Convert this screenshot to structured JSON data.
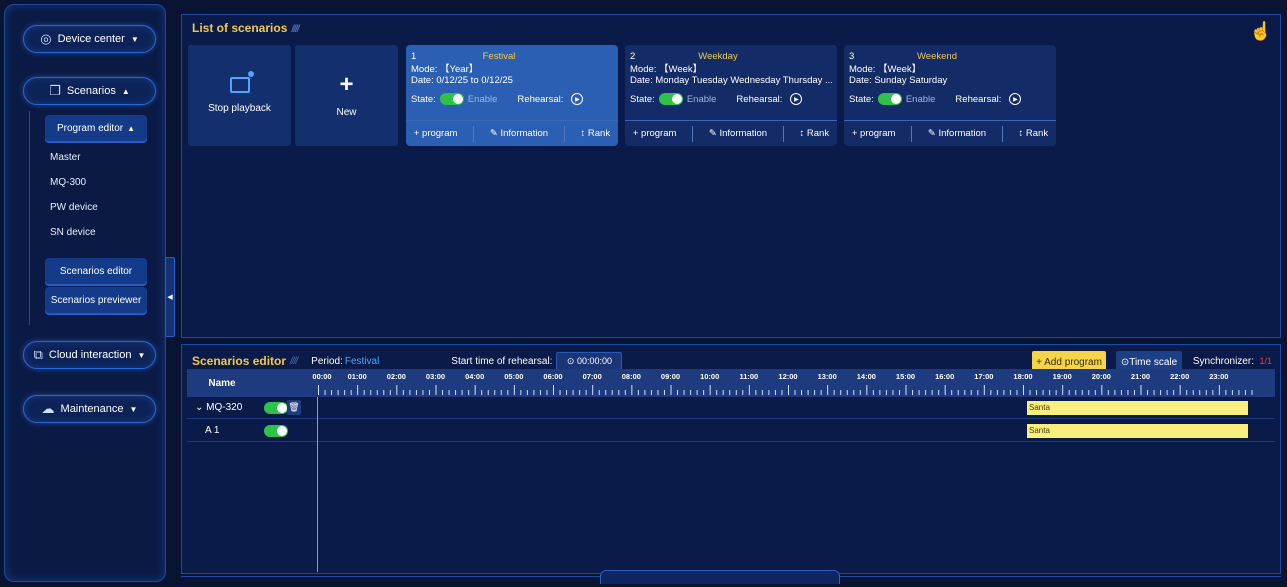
{
  "sidebar": {
    "device_center": "Device center",
    "scenarios": "Scenarios",
    "program_editor": "Program editor",
    "items": [
      "Master",
      "MQ-300",
      "PW device",
      "SN device"
    ],
    "scenarios_editor": "Scenarios editor",
    "scenarios_previewer": "Scenarios previewer",
    "cloud_interaction": "Cloud interaction",
    "maintenance": "Maintenance"
  },
  "scenarios_list": {
    "title": "List of scenarios",
    "title_slashes": "////",
    "stop_playback": "Stop playback",
    "new": "New",
    "cards": [
      {
        "num": "1",
        "name": "Festival",
        "mode": "Mode: 【Year】",
        "date": "Date: 0/12/25 to 0/12/25",
        "state": "State:",
        "enable": "Enable",
        "rehearsal": "Rehearsal:",
        "program": "+ program",
        "information": "Information",
        "rank": "Rank"
      },
      {
        "num": "2",
        "name": "Weekday",
        "mode": "Mode: 【Week】",
        "date": "Date: Monday Tuesday Wednesday Thursday ...",
        "state": "State:",
        "enable": "Enable",
        "rehearsal": "Rehearsal:",
        "program": "+ program",
        "information": "Information",
        "rank": "Rank"
      },
      {
        "num": "3",
        "name": "Weekend",
        "mode": "Mode: 【Week】",
        "date": "Date: Sunday Saturday",
        "state": "State:",
        "enable": "Enable",
        "rehearsal": "Rehearsal:",
        "program": "+ program",
        "information": "Information",
        "rank": "Rank"
      }
    ]
  },
  "editor": {
    "title": "Scenarios editor",
    "title_slashes": "////",
    "period_label": "Period:",
    "period_value": "Festival",
    "rehearsal_label": "Start time of rehearsal:",
    "rehearsal_value": "⊙ 00:00:00",
    "add_program": "+ Add program",
    "time_scale": "Time scale",
    "synchronizer_label": "Synchronizer:",
    "synchronizer_value": "1/1",
    "name_header": "Name",
    "hours": [
      "00:00",
      "01:00",
      "02:00",
      "03:00",
      "04:00",
      "05:00",
      "06:00",
      "07:00",
      "08:00",
      "09:00",
      "10:00",
      "11:00",
      "12:00",
      "13:00",
      "14:00",
      "15:00",
      "16:00",
      "17:00",
      "18:00",
      "19:00",
      "20:00",
      "21:00",
      "22:00",
      "23:00"
    ],
    "rows": [
      {
        "name": "MQ-320",
        "bar_label": "Santa",
        "start_hour": 18.0,
        "end_hour": 24.0
      },
      {
        "name": "A 1",
        "bar_label": "Santa",
        "start_hour": 18.0,
        "end_hour": 24.0
      }
    ]
  }
}
